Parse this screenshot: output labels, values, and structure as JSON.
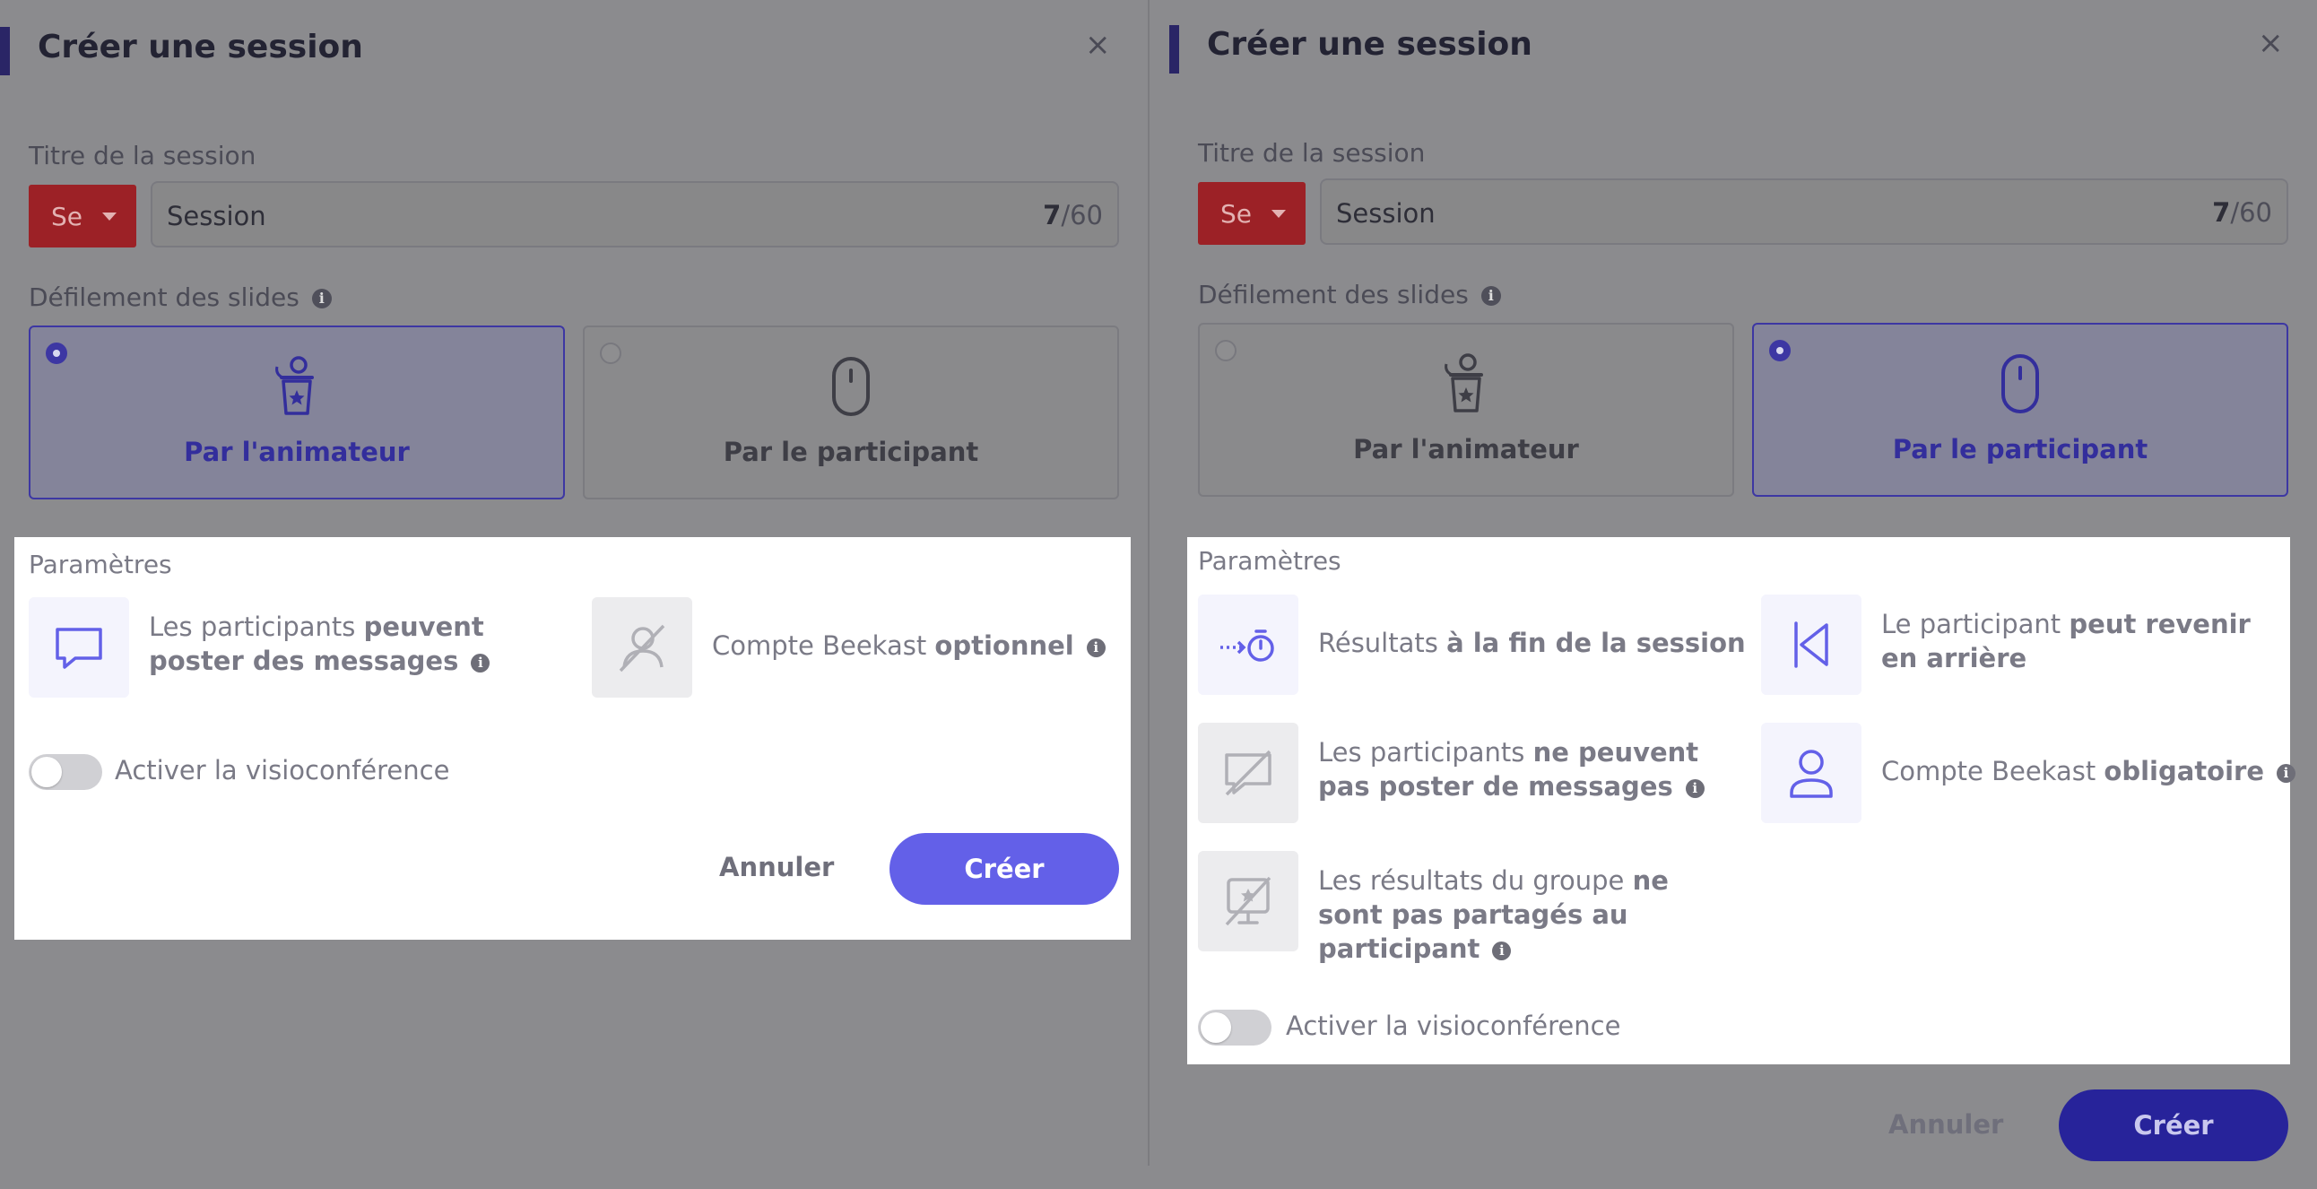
{
  "left": {
    "title": "Créer une session",
    "close": "×",
    "session_title_label": "Titre de la session",
    "prefix_button": "Se",
    "title_value": "Session",
    "char_count_current": "7",
    "char_count_max": "/60",
    "slides_label": "Défilement des slides",
    "options": [
      {
        "label": "Par l'animateur",
        "selected": true
      },
      {
        "label": "Par le participant",
        "selected": false
      }
    ],
    "params_title": "Paramètres",
    "settings": [
      {
        "pre": "Les participants ",
        "bold": "peuvent poster des messages",
        "icon": "message-icon"
      },
      {
        "pre": "Compte Beekast ",
        "bold": "optionnel",
        "icon": "account-off-icon"
      }
    ],
    "video_label": "Activer la visioconférence",
    "video_enabled": false,
    "cancel": "Annuler",
    "create": "Créer"
  },
  "right": {
    "title": "Créer une session",
    "close": "×",
    "session_title_label": "Titre de la session",
    "prefix_button": "Se",
    "title_value": "Session",
    "char_count_current": "7",
    "char_count_max": "/60",
    "slides_label": "Défilement des slides",
    "options": [
      {
        "label": "Par l'animateur",
        "selected": false
      },
      {
        "label": "Par le participant",
        "selected": true
      }
    ],
    "params_title": "Paramètres",
    "settings": [
      {
        "pre": "Résultats ",
        "bold": "à la fin de la session",
        "icon": "timer-icon"
      },
      {
        "pre": "Le participant ",
        "bold": "peut revenir en arrière",
        "icon": "back-icon"
      },
      {
        "pre": "Les participants ",
        "bold": "ne peuvent pas poster de messages",
        "icon": "message-off-icon"
      },
      {
        "pre": "Compte Beekast ",
        "bold": "obligatoire",
        "icon": "user-icon"
      },
      {
        "pre": "Les résultats du groupe ",
        "bold": "ne sont pas partagés au participant",
        "icon": "results-off-icon"
      }
    ],
    "video_label": "Activer la visioconférence",
    "video_enabled": false,
    "cancel": "Annuler",
    "create": "Créer"
  },
  "colors": {
    "accent": "#6360e8",
    "accent_dark": "#27239a",
    "prefix_red": "#9c2126"
  }
}
